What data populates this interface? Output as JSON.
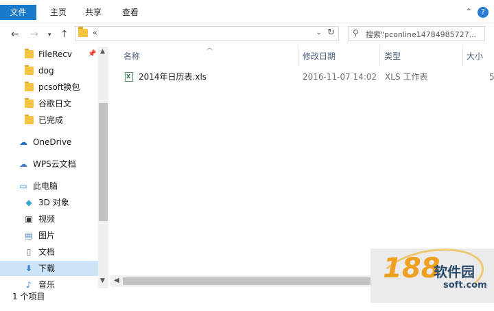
{
  "ribbon": {
    "tabs": [
      {
        "label": "文件"
      },
      {
        "label": "主页"
      },
      {
        "label": "共享"
      },
      {
        "label": "查看"
      }
    ]
  },
  "nav": {
    "address_crumb": "«",
    "search_placeholder": "搜索\"pconline14784985727..."
  },
  "sidebar": {
    "items": [
      {
        "label": "FileRecv",
        "icon": "folder-icon",
        "pinned": true
      },
      {
        "label": "dog",
        "icon": "folder-icon"
      },
      {
        "label": "pcsoft换包",
        "icon": "folder-icon"
      },
      {
        "label": "谷歌日文",
        "icon": "folder-icon"
      },
      {
        "label": "已完成",
        "icon": "folder-icon"
      },
      {
        "label": "OneDrive",
        "icon": "cloud-icon"
      },
      {
        "label": "WPS云文档",
        "icon": "cloud-outline-icon"
      },
      {
        "label": "此电脑",
        "icon": "computer-icon"
      },
      {
        "label": "3D 对象",
        "icon": "cube-icon"
      },
      {
        "label": "视频",
        "icon": "film-icon"
      },
      {
        "label": "图片",
        "icon": "picture-icon"
      },
      {
        "label": "文档",
        "icon": "document-icon"
      },
      {
        "label": "下载",
        "icon": "download-icon",
        "selected": true
      },
      {
        "label": "音乐",
        "icon": "music-icon"
      }
    ]
  },
  "list": {
    "columns": [
      "名称",
      "修改日期",
      "类型",
      "大小"
    ],
    "rows": [
      {
        "name": "2014年日历表.xls",
        "date": "2016-11-07 14:02",
        "type": "XLS 工作表",
        "size": "5"
      }
    ]
  },
  "status": {
    "text": "1 个项目"
  },
  "watermark": {
    "number": "188",
    "name": "软件园",
    "url": "soft.com"
  },
  "colors": {
    "accent": "#1979ca",
    "selection": "#cce4f7",
    "folder": "#f4c543"
  }
}
